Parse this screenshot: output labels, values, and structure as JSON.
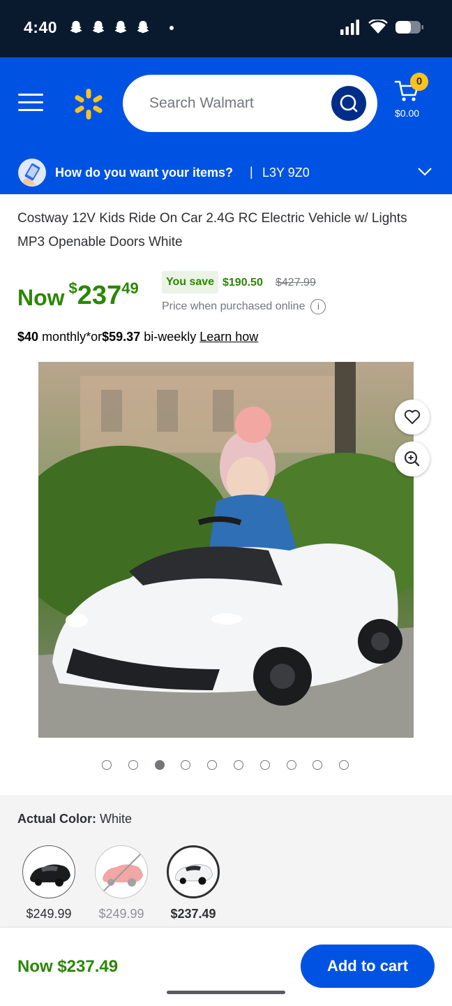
{
  "status_bar": {
    "time": "4:40",
    "notification_icons": [
      "snapchat-icon",
      "snapchat-icon",
      "snapchat-icon",
      "snapchat-icon"
    ],
    "system_icons": [
      "signal-icon",
      "wifi-icon",
      "battery-icon"
    ]
  },
  "header": {
    "search_placeholder": "Search Walmart",
    "cart_count": "0",
    "cart_total": "$0.00",
    "brand_color": "#0053e2",
    "spark_color": "#ffc220"
  },
  "fulfillment": {
    "question": "How do you want your items?",
    "separator": "|",
    "postal_code": "L3Y 9Z0"
  },
  "product": {
    "title": "Costway 12V Kids Ride On Car 2.4G RC Electric Vehicle w/ Lights MP3 Openable Doors White",
    "price_prefix": "Now",
    "price_currency": "$",
    "price_whole": "237",
    "price_cents": "49",
    "you_save_label": "You save",
    "save_amount": "$190.50",
    "was_price": "$427.99",
    "online_note": "Price when purchased online",
    "monthly_amount": "$40",
    "monthly_text": "monthly*or",
    "biweekly_amount": "$59.37",
    "biweekly_text": "bi-weekly",
    "learn_how": "Learn how",
    "price_color": "#2a8703"
  },
  "gallery": {
    "dot_count": 10,
    "active_index": 2
  },
  "variants": {
    "label": "Actual Color:",
    "selected_value": "White",
    "options": [
      {
        "color": "black",
        "price": "$249.99",
        "state": "available"
      },
      {
        "color": "red",
        "price": "$249.99",
        "state": "unavailable"
      },
      {
        "color": "white",
        "price": "$237.49",
        "state": "selected"
      }
    ]
  },
  "bottom_bar": {
    "price": "Now $237.49",
    "add_to_cart": "Add to cart"
  }
}
